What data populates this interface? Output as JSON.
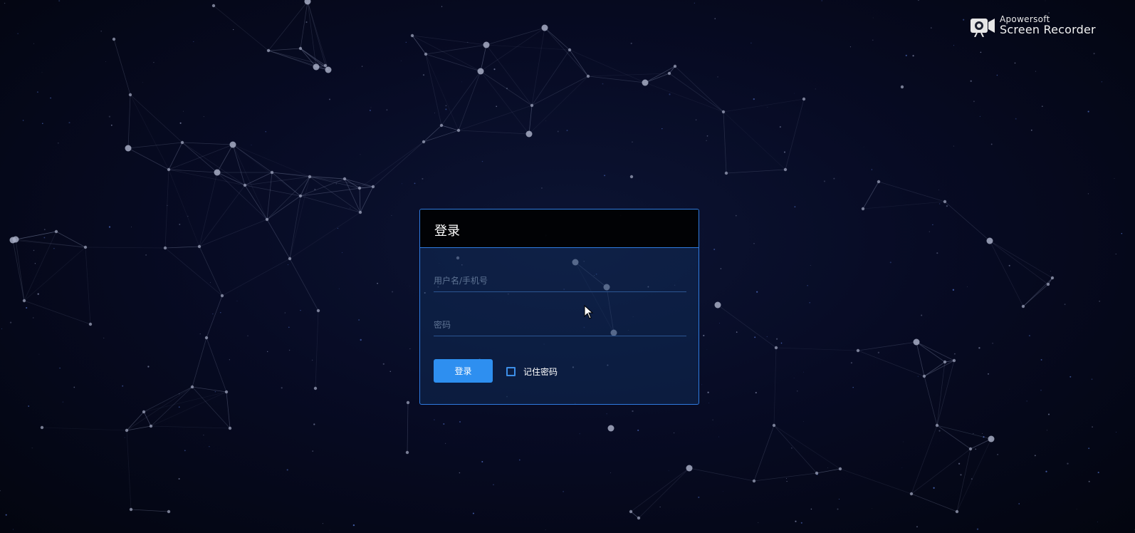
{
  "watermark": {
    "line1": "Apowersoft",
    "line2": "Screen Recorder",
    "icon": "camera-recorder-icon"
  },
  "login": {
    "title": "登录",
    "username_placeholder": "用户名/手机号",
    "username_value": "",
    "password_placeholder": "密码",
    "password_value": "",
    "submit_label": "登录",
    "remember_label": "记住密码",
    "remember_checked": false
  },
  "colors": {
    "background": "#05081c",
    "accent": "#2e8ff0",
    "card_border": "#2f7be0",
    "header_bg": "#000000",
    "network_line": "#8c95b5",
    "network_node": "#a7adc4"
  },
  "background": {
    "decoration": "particle-network-icon"
  }
}
